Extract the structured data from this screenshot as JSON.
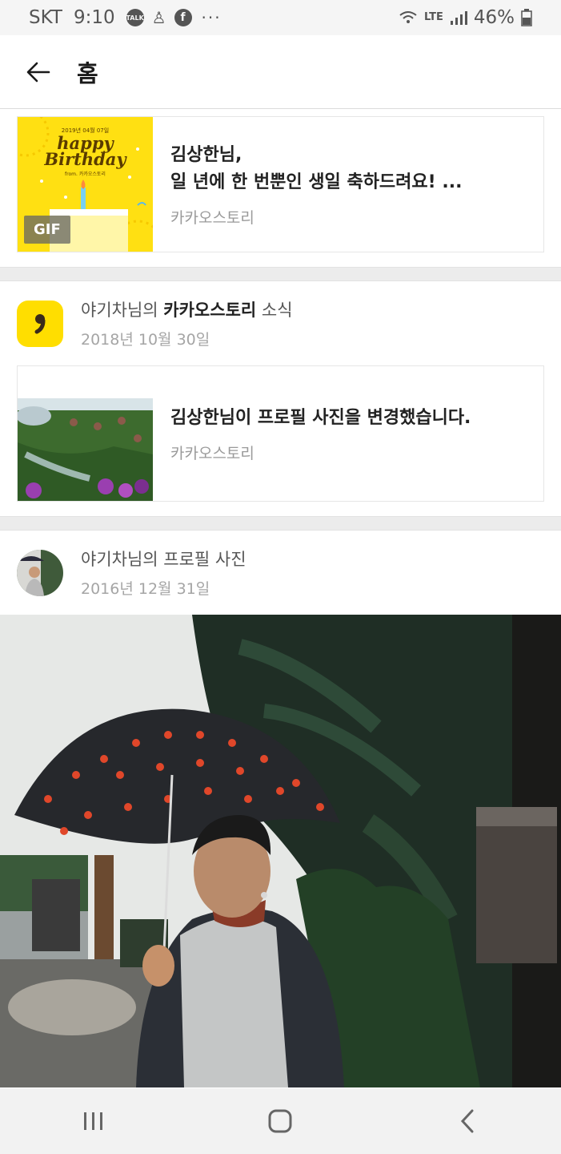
{
  "status": {
    "carrier": "SKT",
    "time": "9:10",
    "notifications": [
      "talk-icon",
      "bell-alt-icon",
      "facebook-icon"
    ],
    "more": "···",
    "network": "LTE",
    "battery": "46%"
  },
  "appbar": {
    "title": "홈"
  },
  "feed": {
    "birthday_card": {
      "title_line1": "김상한님,",
      "title_line2": "일 년에 한 번뿐인 생일 축하드려요! ...",
      "source": "카카오스토리",
      "badge": "GIF",
      "thumb_date": "2019년 04월 07일",
      "thumb_happy": "happy",
      "thumb_birthday": "Birthday",
      "thumb_from": "from. 카카오스토리"
    },
    "story_post": {
      "title_prefix": "야기차님의",
      "title_bold": "카카오스토리",
      "title_suffix": "소식",
      "date": "2018년 10월 30일",
      "card_title": "김상한님이 프로필 사진을 변경했습니다.",
      "card_source": "카카오스토리"
    },
    "profile_post": {
      "title": "야기차님의 프로필 사진",
      "date": "2016년 12월 31일"
    }
  },
  "colors": {
    "kakao_yellow": "#ffde00",
    "page_bg": "#ffffff",
    "divider": "#ececec"
  },
  "navbar": {
    "recents": "recents-icon",
    "home": "home-icon",
    "back": "back-icon"
  }
}
